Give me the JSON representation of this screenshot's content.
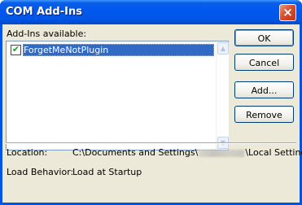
{
  "window": {
    "title": "COM Add-Ins",
    "close_label": "×"
  },
  "addins": {
    "label": "Add-Ins available:",
    "items": [
      {
        "name": "ForgetMeNotPlugin",
        "checked": true,
        "selected": true
      }
    ],
    "scroll_up": "▲",
    "scroll_down": "▼"
  },
  "buttons": {
    "ok": "OK",
    "cancel": "Cancel",
    "add": "Add...",
    "remove": "Remove"
  },
  "details": {
    "location_label": "Location:",
    "location_prefix": "C:\\Documents and Settings\\",
    "location_suffix": "\\Local Settings",
    "load_behavior_label": "Load Behavior:",
    "load_behavior_value": "Load at Startup"
  },
  "icons": {
    "close": "close-icon",
    "checkmark": "checkmark-icon"
  },
  "colors": {
    "titlebar": "#0058ee",
    "selection": "#316ac5",
    "dialog_bg": "#ece9d8",
    "close_button": "#d8502f"
  }
}
